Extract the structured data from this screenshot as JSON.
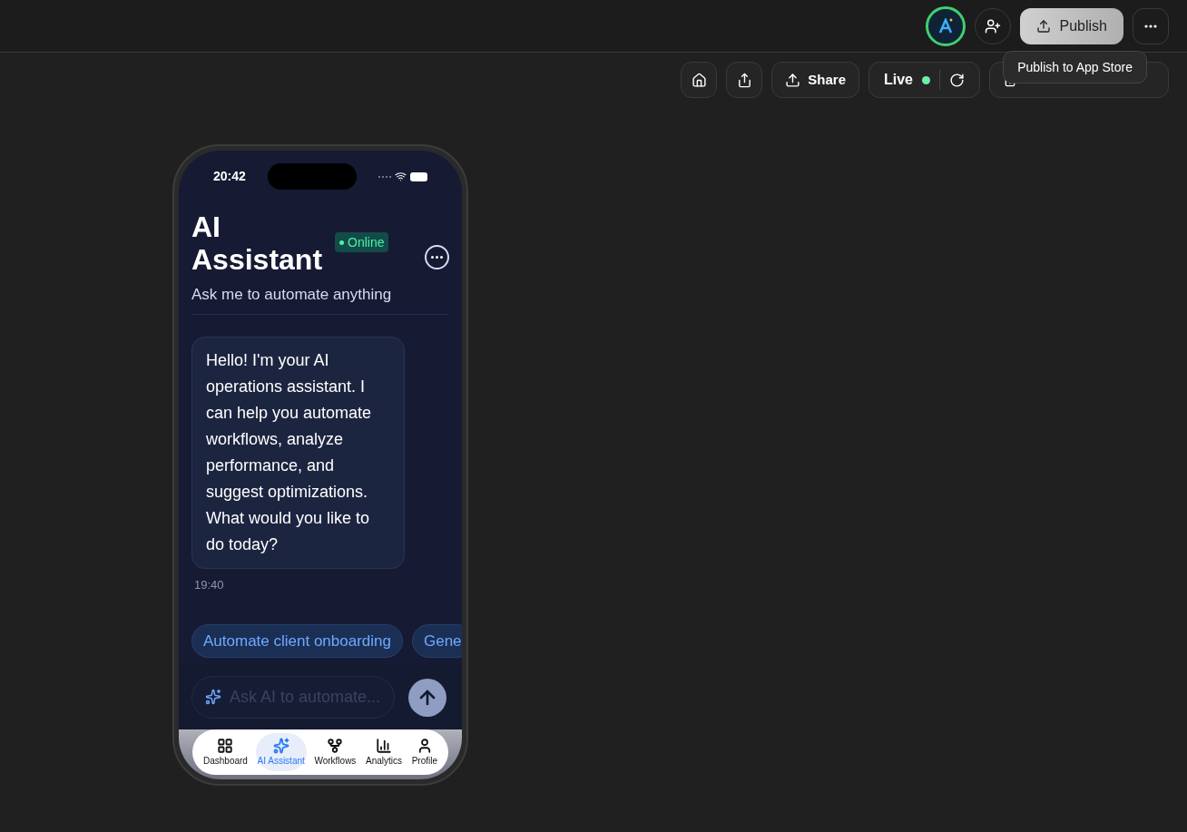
{
  "topbar": {
    "publish": "Publish",
    "tooltip": "Publish to App Store"
  },
  "toolbar": {
    "share": "Share",
    "live": "Live",
    "live_on": true
  },
  "phone": {
    "time": "20:42",
    "title": "AI Assistant",
    "status": "Online",
    "subtitle": "Ask me to automate anything",
    "messages": [
      {
        "text": "Hello! I'm your AI operations assistant. I can help you automate workflows, analyze performance, and suggest optimizations. What would you like to do today?",
        "time": "19:40"
      }
    ],
    "suggestions": [
      "Automate client onboarding",
      "Gene"
    ],
    "input": {
      "placeholder": "Ask AI to automate..."
    },
    "tabs": [
      {
        "label": "Dashboard",
        "kind": "grid",
        "selected": false
      },
      {
        "label": "AI Assistant",
        "kind": "sparkle",
        "selected": true
      },
      {
        "label": "Workflows",
        "kind": "fork",
        "selected": false
      },
      {
        "label": "Analytics",
        "kind": "bars",
        "selected": false
      },
      {
        "label": "Profile",
        "kind": "person",
        "selected": false
      }
    ]
  }
}
